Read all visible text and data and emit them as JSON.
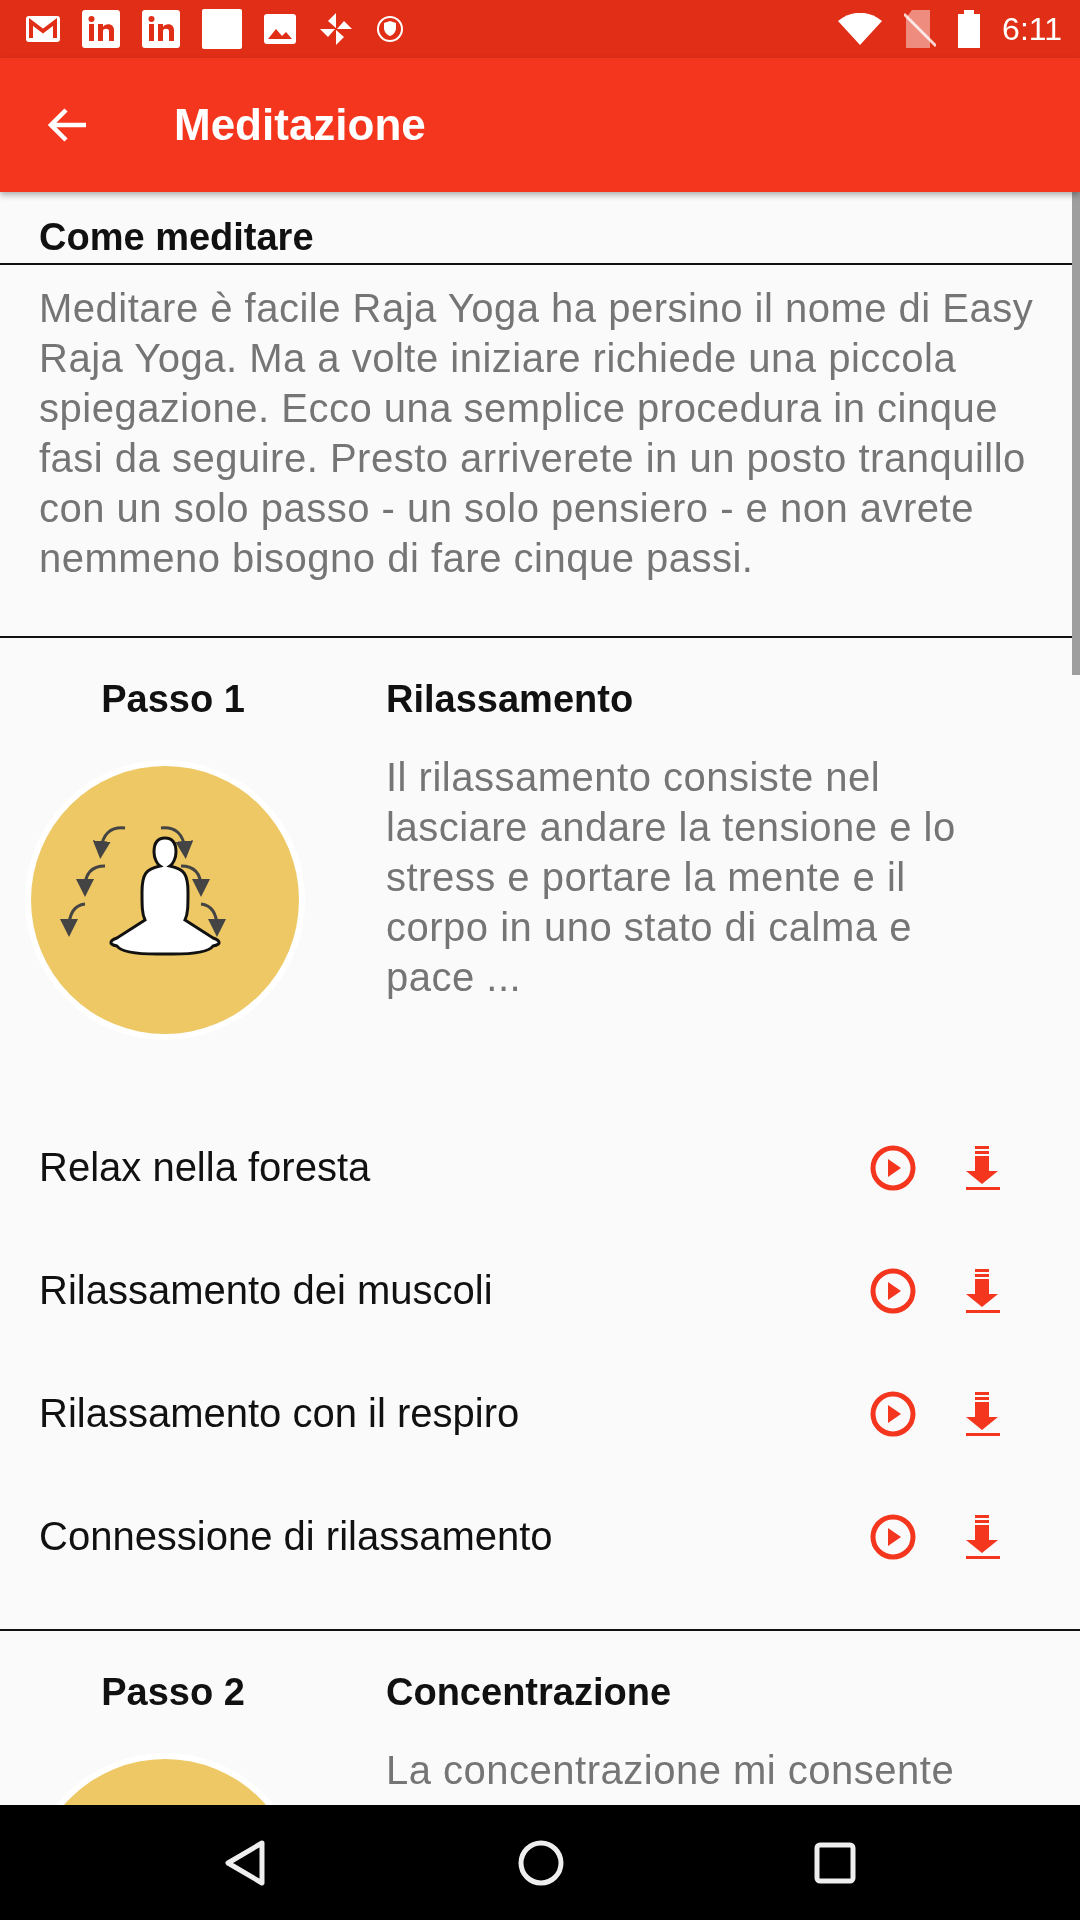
{
  "status_bar": {
    "time": "6:11"
  },
  "app_bar": {
    "title": "Meditazione"
  },
  "intro": {
    "heading": "Come meditare",
    "text": "Meditare è facile Raja Yoga ha persino il nome di Easy Raja Yoga. Ma a volte iniziare richiede una piccola spiegazione. Ecco una semplice procedura in cinque fasi da seguire. Presto arriverete in un posto tranquillo con un solo passo - un solo pensiero - e non avrete nemmeno bisogno di fare cinque passi."
  },
  "steps": [
    {
      "label": "Passo 1",
      "title": "Rilassamento",
      "description": "Il rilassamento consiste nel lasciare andare la tensione e lo stress e portare la mente e il corpo in uno stato di calma e pace ...",
      "tracks": [
        {
          "title": "Relax nella foresta"
        },
        {
          "title": "Rilassamento dei muscoli"
        },
        {
          "title": "Rilassamento con il respiro"
        },
        {
          "title": "Connessione di rilassamento"
        }
      ]
    },
    {
      "label": "Passo 2",
      "title": "Concentrazione",
      "description": "La concentrazione mi consente"
    }
  ]
}
